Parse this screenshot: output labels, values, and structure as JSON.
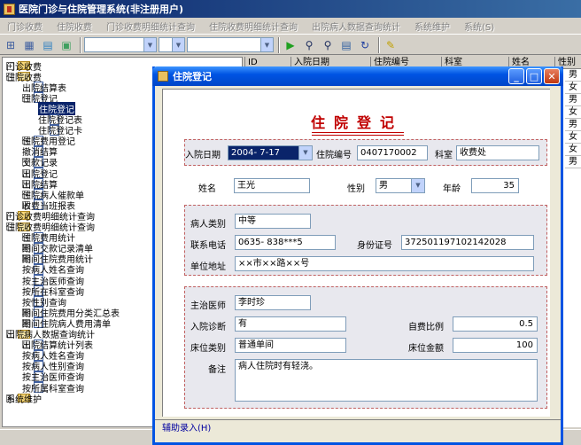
{
  "app": {
    "title": "医院门诊与住院管理系统(非注册用户)"
  },
  "menu": [
    "门诊收费",
    "住院收费",
    "门诊收费明细统计查询",
    "住院收费明细统计查询",
    "出院病人数据查询统计",
    "系统维护",
    "系统(S)"
  ],
  "tree": [
    {
      "label": "门诊收费",
      "level": 0,
      "type": "folder",
      "expander": "+"
    },
    {
      "label": "住院收费",
      "level": 0,
      "type": "folder-open",
      "expander": "-"
    },
    {
      "label": "出院结算表",
      "level": 1,
      "type": "doc",
      "expander": ""
    },
    {
      "label": "住院登记",
      "level": 1,
      "type": "doc",
      "expander": "-"
    },
    {
      "label": "住院登记",
      "level": 2,
      "type": "doc-sel",
      "expander": "",
      "selected": true
    },
    {
      "label": "住院登记表",
      "level": 2,
      "type": "doc",
      "expander": ""
    },
    {
      "label": "住院登记卡",
      "level": 2,
      "type": "doc",
      "expander": ""
    },
    {
      "label": "住院费用登记",
      "level": 1,
      "type": "doc",
      "expander": "+"
    },
    {
      "label": "撤消结算",
      "level": 1,
      "type": "doc",
      "expander": ""
    },
    {
      "label": "交款记录",
      "level": 1,
      "type": "doc",
      "expander": "+"
    },
    {
      "label": "出院登记",
      "level": 1,
      "type": "doc",
      "expander": "+"
    },
    {
      "label": "出院结算",
      "level": 1,
      "type": "doc",
      "expander": "+"
    },
    {
      "label": "住院病人催款单",
      "level": 1,
      "type": "doc",
      "expander": "+"
    },
    {
      "label": "收费当班报表",
      "level": 1,
      "type": "doc",
      "expander": "+"
    },
    {
      "label": "门诊收费明细统计查询",
      "level": 0,
      "type": "folder",
      "expander": "+"
    },
    {
      "label": "住院收费明细统计查询",
      "level": 0,
      "type": "folder-open",
      "expander": "-"
    },
    {
      "label": "住院费用统计",
      "level": 1,
      "type": "doc",
      "expander": "+"
    },
    {
      "label": "期间交款记录清单",
      "level": 1,
      "type": "doc",
      "expander": "+"
    },
    {
      "label": "期间住院费用统计",
      "level": 1,
      "type": "doc",
      "expander": "+"
    },
    {
      "label": "按病人姓名查询",
      "level": 1,
      "type": "doc",
      "expander": ""
    },
    {
      "label": "按主治医师查询",
      "level": 1,
      "type": "doc",
      "expander": ""
    },
    {
      "label": "按所在科室查询",
      "level": 1,
      "type": "doc",
      "expander": ""
    },
    {
      "label": "按性别查询",
      "level": 1,
      "type": "doc",
      "expander": ""
    },
    {
      "label": "期间住院费用分类汇总表",
      "level": 1,
      "type": "doc",
      "expander": "+"
    },
    {
      "label": "期间住院病人费用清单",
      "level": 1,
      "type": "doc",
      "expander": "+"
    },
    {
      "label": "出院病人数据查询统计",
      "level": 0,
      "type": "folder-open",
      "expander": "-"
    },
    {
      "label": "出院结算统计列表",
      "level": 1,
      "type": "doc",
      "expander": "+"
    },
    {
      "label": "按病人姓名查询",
      "level": 1,
      "type": "doc",
      "expander": ""
    },
    {
      "label": "按病人性别查询",
      "level": 1,
      "type": "doc",
      "expander": ""
    },
    {
      "label": "按主治医师查询",
      "level": 1,
      "type": "doc",
      "expander": ""
    },
    {
      "label": "按所属科室查询",
      "level": 1,
      "type": "doc",
      "expander": ""
    },
    {
      "label": "系统维护",
      "level": 0,
      "type": "folder",
      "expander": "+"
    }
  ],
  "bg_table": {
    "headers": [
      "ID",
      "入院日期",
      "住院编号",
      "科室",
      "姓名",
      "性别"
    ],
    "side_values": [
      "男",
      "女",
      "男",
      "女",
      "男",
      "女",
      "女",
      "男"
    ]
  },
  "dialog": {
    "title": "住院登记",
    "form_title": "住院登记",
    "admit_date": {
      "label": "入院日期",
      "value": "2004- 7-17"
    },
    "hosp_no": {
      "label": "住院编号",
      "value": "0407170002"
    },
    "dept": {
      "label": "科室",
      "value": "收费处"
    },
    "name": {
      "label": "姓名",
      "value": "王光"
    },
    "gender": {
      "label": "性别",
      "value": "男"
    },
    "age": {
      "label": "年龄",
      "value": "35"
    },
    "patient_type": {
      "label": "病人类别",
      "value": "中等"
    },
    "phone": {
      "label": "联系电话",
      "value": "0635- 838***5"
    },
    "id_no": {
      "label": "身份证号",
      "value": "372501197102142028"
    },
    "address": {
      "label": "单位地址",
      "value": "××市××路××号"
    },
    "doctor": {
      "label": "主治医师",
      "value": "李时珍"
    },
    "diagnosis": {
      "label": "入院诊断",
      "value": "有"
    },
    "self_pay": {
      "label": "自费比例",
      "value": "0.5"
    },
    "bed_type": {
      "label": "床位类别",
      "value": "普通单间"
    },
    "bed_fee": {
      "label": "床位金额",
      "value": "100"
    },
    "remark": {
      "label": "备注",
      "value": "病人住院时有轻浇。"
    },
    "aux_label": "辅助录入(H)"
  }
}
